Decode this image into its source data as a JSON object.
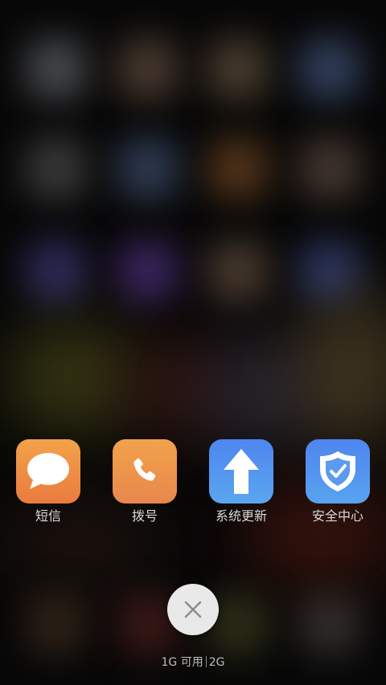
{
  "recent_apps": [
    {
      "label": "短信",
      "icon": "message-bubble-icon",
      "color": "#ee8f44"
    },
    {
      "label": "拨号",
      "icon": "phone-handset-icon",
      "color": "#ec9448"
    },
    {
      "label": "系统更新",
      "icon": "up-arrow-icon",
      "color": "#5393ef"
    },
    {
      "label": "安全中心",
      "icon": "shield-check-icon",
      "color": "#5393ef"
    }
  ],
  "clear_button": {
    "icon": "close-icon"
  },
  "memory": {
    "available": "1G 可用",
    "total": "2G"
  }
}
